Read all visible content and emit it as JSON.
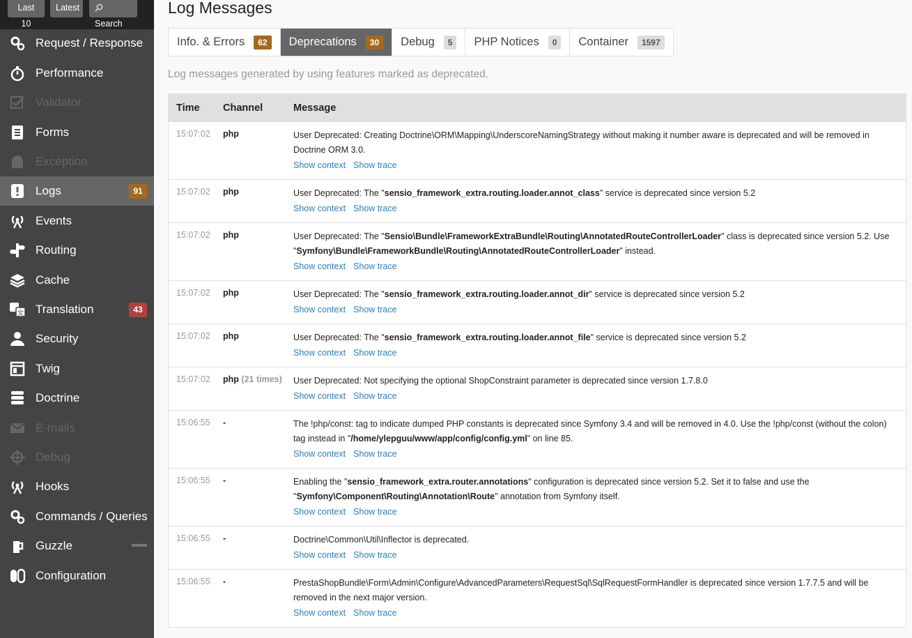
{
  "sidebar": {
    "top_buttons": {
      "last10": "Last 10",
      "latest": "Latest",
      "search": "Search"
    },
    "items": [
      {
        "label": "Request / Response",
        "icon": "gears-icon",
        "disabled": false
      },
      {
        "label": "Performance",
        "icon": "stopwatch-icon",
        "disabled": false
      },
      {
        "label": "Validator",
        "icon": "checkbox-icon",
        "disabled": true
      },
      {
        "label": "Forms",
        "icon": "form-icon",
        "disabled": false
      },
      {
        "label": "Exception",
        "icon": "ghost-icon",
        "disabled": true
      },
      {
        "label": "Logs",
        "icon": "logs-icon",
        "disabled": false,
        "selected": true,
        "count": "91",
        "count_color": "#a46a1f"
      },
      {
        "label": "Events",
        "icon": "antenna-icon",
        "disabled": false
      },
      {
        "label": "Routing",
        "icon": "signpost-icon",
        "disabled": false
      },
      {
        "label": "Cache",
        "icon": "layers-icon",
        "disabled": false
      },
      {
        "label": "Translation",
        "icon": "translation-icon",
        "disabled": false,
        "count": "43",
        "count_color": "#b0413e"
      },
      {
        "label": "Security",
        "icon": "user-icon",
        "disabled": false
      },
      {
        "label": "Twig",
        "icon": "template-icon",
        "disabled": false
      },
      {
        "label": "Doctrine",
        "icon": "database-icon",
        "disabled": false
      },
      {
        "label": "E-mails",
        "icon": "envelope-icon",
        "disabled": true
      },
      {
        "label": "Debug",
        "icon": "crosshair-icon",
        "disabled": true
      },
      {
        "label": "Hooks",
        "icon": "antenna-icon",
        "disabled": false
      },
      {
        "label": "Commands / Queries",
        "icon": "gears-icon",
        "disabled": false
      },
      {
        "label": "Guzzle",
        "icon": "guzzle-icon",
        "disabled": false
      },
      {
        "label": "Configuration",
        "icon": "toggle-icon",
        "disabled": false
      }
    ]
  },
  "main": {
    "title": "Log Messages",
    "tabs": [
      {
        "label": "Info. & Errors",
        "count": "62",
        "active": false,
        "warn": true
      },
      {
        "label": "Deprecations",
        "count": "30",
        "active": true,
        "warn": true
      },
      {
        "label": "Debug",
        "count": "5",
        "active": false,
        "warn": false
      },
      {
        "label": "PHP Notices",
        "count": "0",
        "active": false,
        "warn": false
      },
      {
        "label": "Container",
        "count": "1597",
        "active": false,
        "warn": false
      }
    ],
    "description": "Log messages generated by using features marked as deprecated.",
    "table": {
      "headers": {
        "time": "Time",
        "channel": "Channel",
        "message": "Message"
      },
      "show_context": "Show context",
      "show_trace": "Show trace",
      "rows": [
        {
          "time": "15:07:02",
          "channel": "php",
          "times": "",
          "parts": [
            {
              "t": "User Deprecated: Creating Doctrine\\ORM\\Mapping\\UnderscoreNamingStrategy without making it number aware is deprecated and will be removed in Doctrine ORM 3.0."
            }
          ]
        },
        {
          "time": "15:07:02",
          "channel": "php",
          "times": "",
          "parts": [
            {
              "t": "User Deprecated: The \""
            },
            {
              "b": "sensio_framework_extra.routing.loader.annot_class"
            },
            {
              "t": "\" service is deprecated since version 5.2"
            }
          ]
        },
        {
          "time": "15:07:02",
          "channel": "php",
          "times": "",
          "parts": [
            {
              "t": "User Deprecated: The \""
            },
            {
              "b": "Sensio\\Bundle\\FrameworkExtraBundle\\Routing\\AnnotatedRouteControllerLoader"
            },
            {
              "t": "\" class is deprecated since version 5.2. Use \""
            },
            {
              "b": "Symfony\\Bundle\\FrameworkBundle\\Routing\\AnnotatedRouteControllerLoader"
            },
            {
              "t": "\" instead."
            }
          ]
        },
        {
          "time": "15:07:02",
          "channel": "php",
          "times": "",
          "parts": [
            {
              "t": "User Deprecated: The \""
            },
            {
              "b": "sensio_framework_extra.routing.loader.annot_dir"
            },
            {
              "t": "\" service is deprecated since version 5.2"
            }
          ]
        },
        {
          "time": "15:07:02",
          "channel": "php",
          "times": "",
          "parts": [
            {
              "t": "User Deprecated: The \""
            },
            {
              "b": "sensio_framework_extra.routing.loader.annot_file"
            },
            {
              "t": "\" service is deprecated since version 5.2"
            }
          ]
        },
        {
          "time": "15:07:02",
          "channel": "php",
          "times": "(21 times)",
          "parts": [
            {
              "t": "User Deprecated: Not specifying the optional ShopConstraint parameter is deprecated since version 1.7.8.0"
            }
          ]
        },
        {
          "time": "15:06:55",
          "channel": "-",
          "times": "",
          "parts": [
            {
              "t": "The !php/const: tag to indicate dumped PHP constants is deprecated since Symfony 3.4 and will be removed in 4.0. Use the !php/const (without the colon) tag instead in \""
            },
            {
              "b": "/home/ylepguu/www/app/config/config.yml"
            },
            {
              "t": "\" on line 85."
            }
          ]
        },
        {
          "time": "15:06:55",
          "channel": "-",
          "times": "",
          "parts": [
            {
              "t": "Enabling the \""
            },
            {
              "b": "sensio_framework_extra.router.annotations"
            },
            {
              "t": "\" configuration is deprecated since version 5.2. Set it to false and use the \""
            },
            {
              "b": "Symfony\\Component\\Routing\\Annotation\\Route"
            },
            {
              "t": "\" annotation from Symfony itself."
            }
          ]
        },
        {
          "time": "15:06:55",
          "channel": "-",
          "times": "",
          "parts": [
            {
              "t": "Doctrine\\Common\\Util\\Inflector is deprecated."
            }
          ]
        },
        {
          "time": "15:06:55",
          "channel": "-",
          "times": "",
          "parts": [
            {
              "t": "PrestaShopBundle\\Form\\Admin\\Configure\\AdvancedParameters\\RequestSql\\SqlRequestFormHandler is deprecated since version 1.7.7.5 and will be removed in the next major version."
            }
          ]
        }
      ]
    }
  }
}
